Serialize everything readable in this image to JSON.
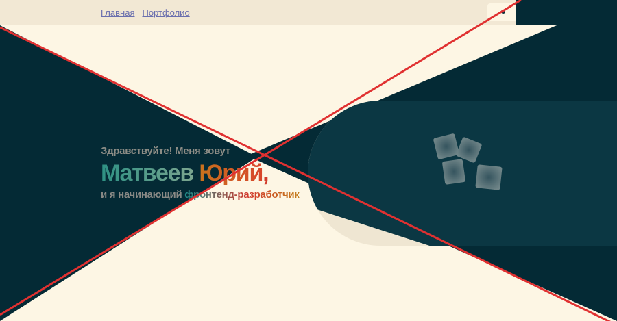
{
  "nav": {
    "items": [
      {
        "label": "Главная"
      },
      {
        "label": "Портфолио"
      }
    ]
  },
  "theme_toggle": {
    "icon": "gear-icon"
  },
  "hero": {
    "greeting": "Здравствуйте! Меня зовут",
    "name_first": "Матвеев",
    "name_last": "Юрий",
    "name_punct": ",",
    "role_prefix": "и я начинающий ",
    "role_highlight": "фронтенд-разработчик"
  },
  "illustration": {
    "icon": "cubes-icon"
  },
  "overlay": {
    "icon": "cross-out-icon",
    "color": "#e03131"
  },
  "colors": {
    "dark_bg": "#042a35",
    "cream_bg": "#fdf6e4",
    "nav_link": "#6a6fae"
  }
}
